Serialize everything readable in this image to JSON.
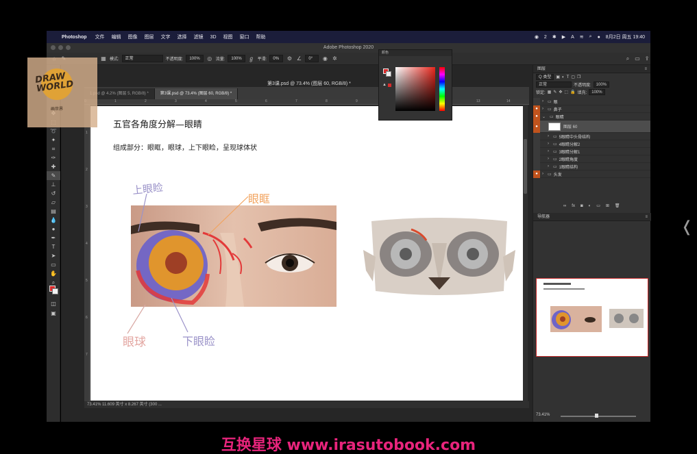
{
  "menubar": {
    "app": "Photoshop",
    "items": [
      "文件",
      "编辑",
      "图像",
      "图层",
      "文字",
      "选择",
      "滤镜",
      "3D",
      "视图",
      "窗口",
      "帮助"
    ],
    "right": {
      "wechat_count": "2",
      "date_time": "8月2日 周五 19:40"
    }
  },
  "window": {
    "title": "Adobe Photoshop 2020"
  },
  "options": {
    "mode_label": "模式:",
    "mode_value": "正常",
    "opacity_label": "不透明度:",
    "opacity_value": "100%",
    "flow_label": "流量:",
    "flow_value": "100%",
    "smooth_label": "平滑:",
    "smooth_value": "0%",
    "angle_value": "0°"
  },
  "logo": {
    "line1": "DRAW",
    "line2": "WORLD",
    "sub": "画世界"
  },
  "document": {
    "title": "第3课.psd @ 73.4% (图层 60, RGB/8) *",
    "tabs": [
      {
        "label": "1.psd @ 4.2% (图层 5, RGB/8) *"
      },
      {
        "label": "第3课.psd @ 73.4% (图层 60, RGB/8) *"
      }
    ],
    "ruler_marks": [
      "0",
      "1",
      "2",
      "3",
      "4",
      "5",
      "6",
      "7",
      "8",
      "9",
      "10",
      "11",
      "12",
      "13",
      "14",
      "15"
    ],
    "ruler_left_marks": [
      "1",
      "2",
      "3",
      "4",
      "5",
      "6",
      "7"
    ],
    "status": "73.41%    11.609 英寸 x 8.267 英寸 (300 ..."
  },
  "canvas": {
    "title": "五官各角度分解—眼睛",
    "subtitle": "组成部分：眼眶，眼球，上下眼睑，呈现球体状",
    "annotations": {
      "upper_lid": "上眼睑",
      "orbit": "眼眶",
      "eyeball": "眼球",
      "lower_lid": "下眼睑"
    }
  },
  "color_panel": {
    "title": "颜色"
  },
  "layers_panel": {
    "title": "图层",
    "kind_label": "Q 类型",
    "blend_value": "正常",
    "opacity_label": "不透明度:",
    "opacity_value": "100%",
    "fill_label": "填充:",
    "fill_value": "100%",
    "lock_label": "锁定:",
    "rows": [
      {
        "name": "眼",
        "type": "group",
        "visible": false,
        "indent": 0
      },
      {
        "name": "鼻子",
        "type": "group",
        "visible": true,
        "indent": 0
      },
      {
        "name": "眼睛",
        "type": "group",
        "visible": true,
        "indent": 0
      },
      {
        "name": "图层 60",
        "type": "layer",
        "visible": true,
        "indent": 1,
        "selected": true
      },
      {
        "name": "5眼睛中头骨结构",
        "type": "group",
        "visible": false,
        "indent": 1
      },
      {
        "name": "4眼睛分解2",
        "type": "group",
        "visible": false,
        "indent": 1
      },
      {
        "name": "3眼睛分解1",
        "type": "group",
        "visible": false,
        "indent": 1
      },
      {
        "name": "2眼睛角度",
        "type": "group",
        "visible": false,
        "indent": 1
      },
      {
        "name": "1眼睛结构",
        "type": "group",
        "visible": false,
        "indent": 1
      },
      {
        "name": "头发",
        "type": "group",
        "visible": true,
        "indent": 0
      }
    ]
  },
  "navigator": {
    "title": "导航器",
    "zoom": "73.41%"
  },
  "watermark": "互换星球 www.irasutobook.com",
  "colors": {
    "accent_red": "#d92b2b",
    "layer_eye_orange": "#c0531d",
    "watermark_pink": "#e8247c"
  }
}
